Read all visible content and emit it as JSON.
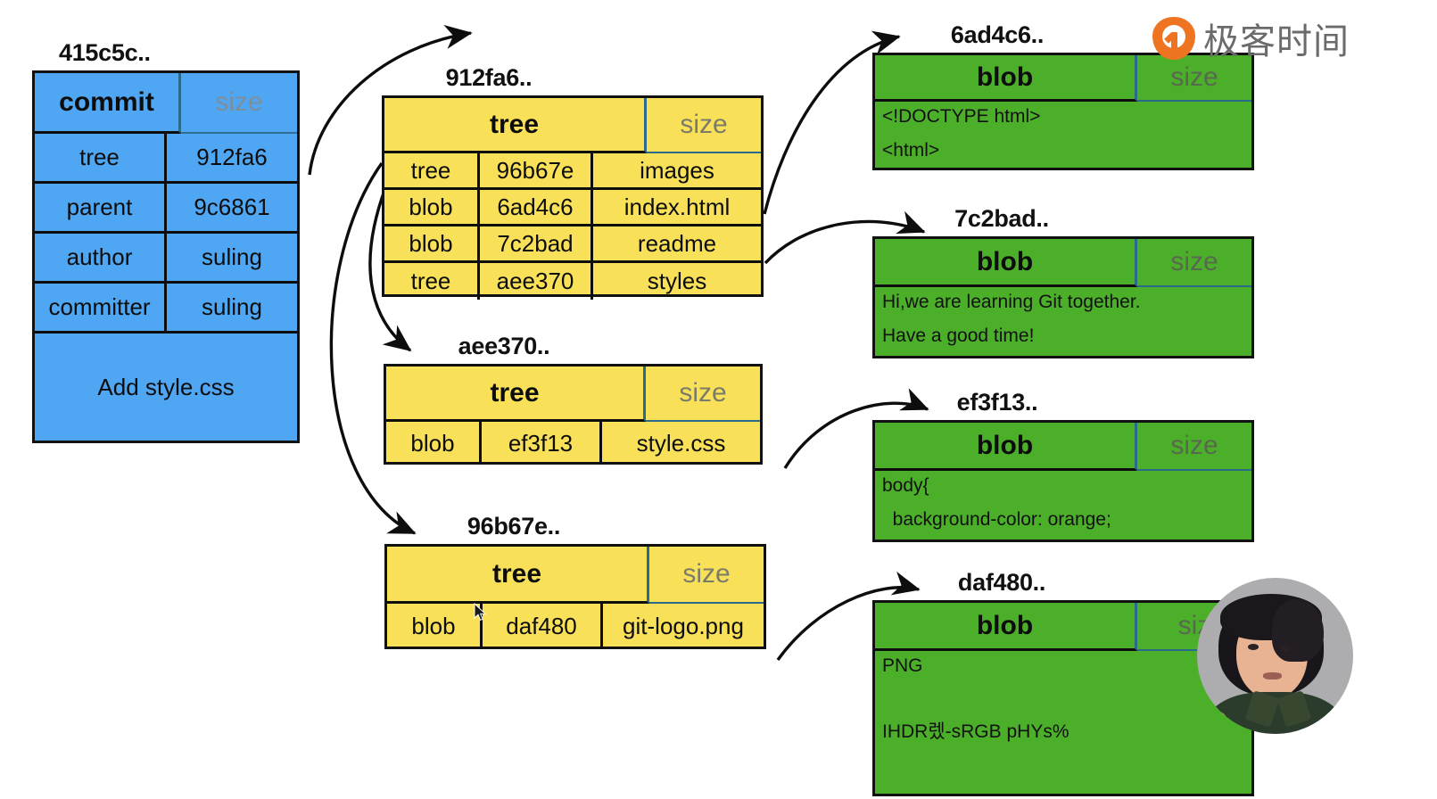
{
  "diagram": {
    "title": "Git object model: commit, tree and blob objects",
    "colors": {
      "commit": "#4FA6F2",
      "tree": "#F8E159",
      "blob": "#4CAF2A",
      "border": "#0D0D0D",
      "size_accent": "#2A6B8C"
    }
  },
  "commit_object": {
    "hash": "415c5c..",
    "type": "commit",
    "size_label": "size",
    "rows": [
      {
        "key": "tree",
        "value": "912fa6"
      },
      {
        "key": "parent",
        "value": "9c6861"
      },
      {
        "key": "author",
        "value": "suling"
      },
      {
        "key": "committer",
        "value": "suling"
      }
    ],
    "message": "Add style.css"
  },
  "tree_objects": [
    {
      "hash": "912fa6..",
      "type": "tree",
      "size_label": "size",
      "entries": [
        {
          "mode": "tree",
          "hash": "96b67e",
          "name": "images"
        },
        {
          "mode": "blob",
          "hash": "6ad4c6",
          "name": "index.html"
        },
        {
          "mode": "blob",
          "hash": "7c2bad",
          "name": "readme"
        },
        {
          "mode": "tree",
          "hash": "aee370",
          "name": "styles"
        }
      ]
    },
    {
      "hash": "aee370..",
      "type": "tree",
      "size_label": "size",
      "entries": [
        {
          "mode": "blob",
          "hash": "ef3f13",
          "name": "style.css"
        }
      ]
    },
    {
      "hash": "96b67e..",
      "type": "tree",
      "size_label": "size",
      "entries": [
        {
          "mode": "blob",
          "hash": "daf480",
          "name": "git-logo.png"
        }
      ]
    }
  ],
  "blob_objects": [
    {
      "hash": "6ad4c6..",
      "type": "blob",
      "size_label": "size",
      "content": [
        "<!DOCTYPE html>",
        "<html>"
      ]
    },
    {
      "hash": "7c2bad..",
      "type": "blob",
      "size_label": "size",
      "content": [
        "Hi,we are learning Git together.",
        "Have a good time!"
      ]
    },
    {
      "hash": "ef3f13..",
      "type": "blob",
      "size_label": "size",
      "content": [
        "body{",
        "  background-color: orange;"
      ]
    },
    {
      "hash": "daf480..",
      "type": "blob",
      "size_label": "siz",
      "content": [
        "PNG",
        "",
        "IHDR렜-sRGB pHYs%"
      ]
    }
  ],
  "branding": {
    "logo_icon": "geektime-logo-icon",
    "wordmark": "极客时间"
  },
  "presenter": {
    "label": "presenter-video-bubble"
  }
}
